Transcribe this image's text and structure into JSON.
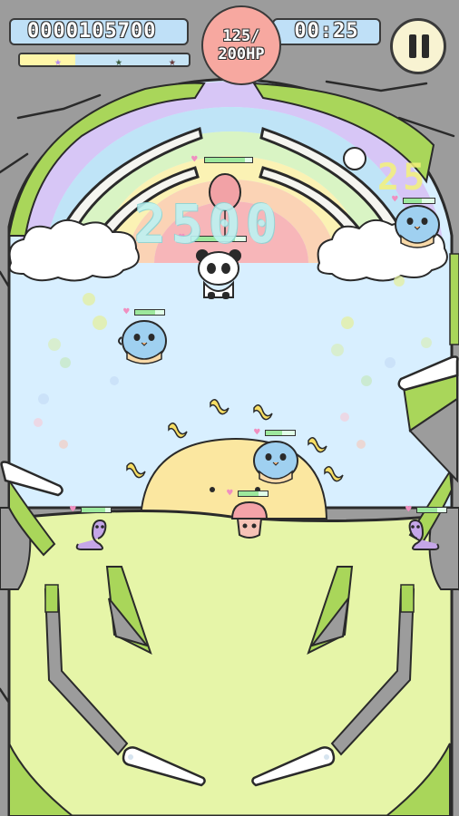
{
  "hud": {
    "score": "0000105700",
    "hp_current": "125/",
    "hp_max": "200HP",
    "timer": "00:25",
    "pause_icon": "pause-icon",
    "level_progress": 0.33,
    "stars": [
      "star-icon",
      "star-icon",
      "star-icon"
    ]
  },
  "popups": {
    "points": "2500",
    "combo": "25"
  },
  "colors": {
    "playfield": "#d8efff",
    "grass": "#e6f5a8",
    "wall": "#9a9a9a",
    "moss": "#a9d65a",
    "sun": "#fbe7a0",
    "hud_panel": "#bfe0f7",
    "hp_orb": "#f7a8a0"
  },
  "enemies": [
    {
      "name": "panda-balloon-enemy",
      "health": 0.85
    },
    {
      "name": "blue-penguin-enemy-left",
      "health": 0.7
    },
    {
      "name": "blue-penguin-enemy-right",
      "health": 0.6
    },
    {
      "name": "blue-penguin-enemy-center",
      "health": 0.55
    },
    {
      "name": "pink-mushroom-enemy",
      "health": 0.7
    },
    {
      "name": "purple-worm-enemy-left",
      "health": 0.8
    },
    {
      "name": "purple-worm-enemy-right",
      "health": 0.7
    }
  ]
}
